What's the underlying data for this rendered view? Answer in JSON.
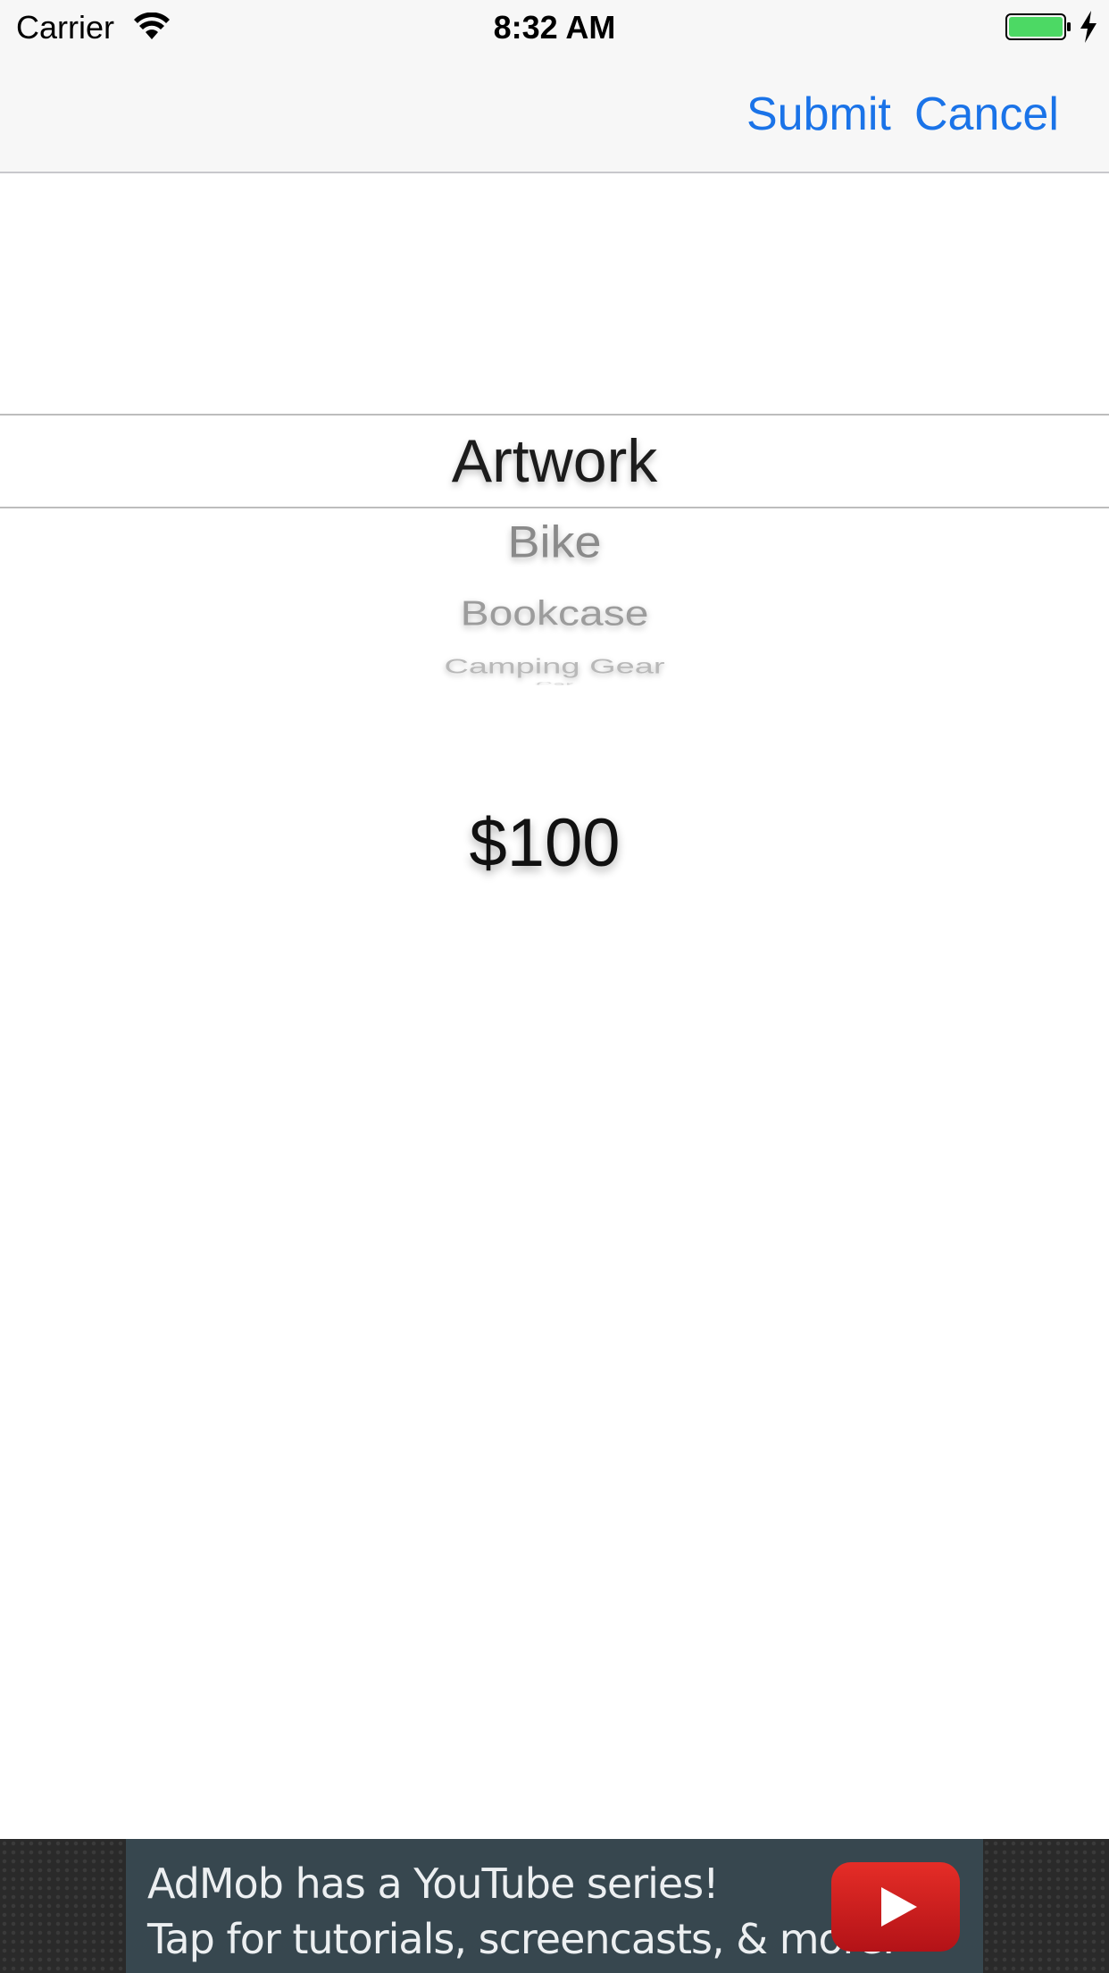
{
  "status_bar": {
    "carrier": "Carrier",
    "time": "8:32 AM",
    "wifi_icon": "wifi-icon",
    "battery_icon": "battery-icon",
    "charging_icon": "charging-bolt-icon",
    "battery_color": "#4cd964"
  },
  "nav": {
    "submit_label": "Submit",
    "cancel_label": "Cancel",
    "tint_color": "#1a73e8"
  },
  "picker": {
    "selected": "Artwork",
    "items_below": [
      "Bike",
      "Bookcase",
      "Camping Gear",
      "Car"
    ]
  },
  "price": "$100",
  "ad": {
    "line1": "AdMob has a YouTube series!",
    "line2": "Tap for tutorials, screencasts, & more.",
    "icon": "youtube-play-icon",
    "icon_color": "#d7141b"
  }
}
